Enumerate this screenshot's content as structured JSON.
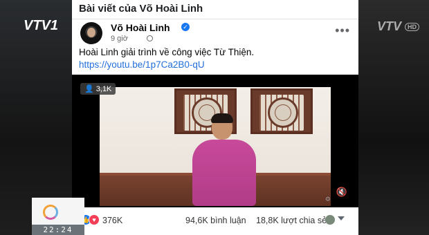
{
  "broadcast": {
    "channel_logo": "VTV1",
    "channel_logo_right": "VTV",
    "hd_badge": "HD",
    "clock_time": "22:24"
  },
  "post_header": {
    "title": "Bài viết của Võ Hoài Linh"
  },
  "author": {
    "name": "Võ Hoài Linh",
    "verified": true,
    "time": "9 giờ",
    "privacy_icon": "globe-icon",
    "more_icon": "more-icon"
  },
  "post": {
    "text": "Hoài Linh giải trình về công việc Từ Thiện.",
    "link": "https://youtu.be/1p7Ca2B0-qU"
  },
  "video": {
    "viewers": "3,1K",
    "viewer_icon": "person-icon",
    "mute_icon": "mute-icon"
  },
  "reactions": {
    "count": "376K",
    "comments": "94,6K bình luận",
    "shares": "18,8K lượt chia sẻ",
    "icons": [
      "like-icon",
      "love-icon"
    ]
  },
  "colors": {
    "facebook_blue": "#1877f2",
    "link_blue": "#216fdb",
    "love_red": "#f33e58",
    "shirt_pink": "#c84a9a"
  }
}
